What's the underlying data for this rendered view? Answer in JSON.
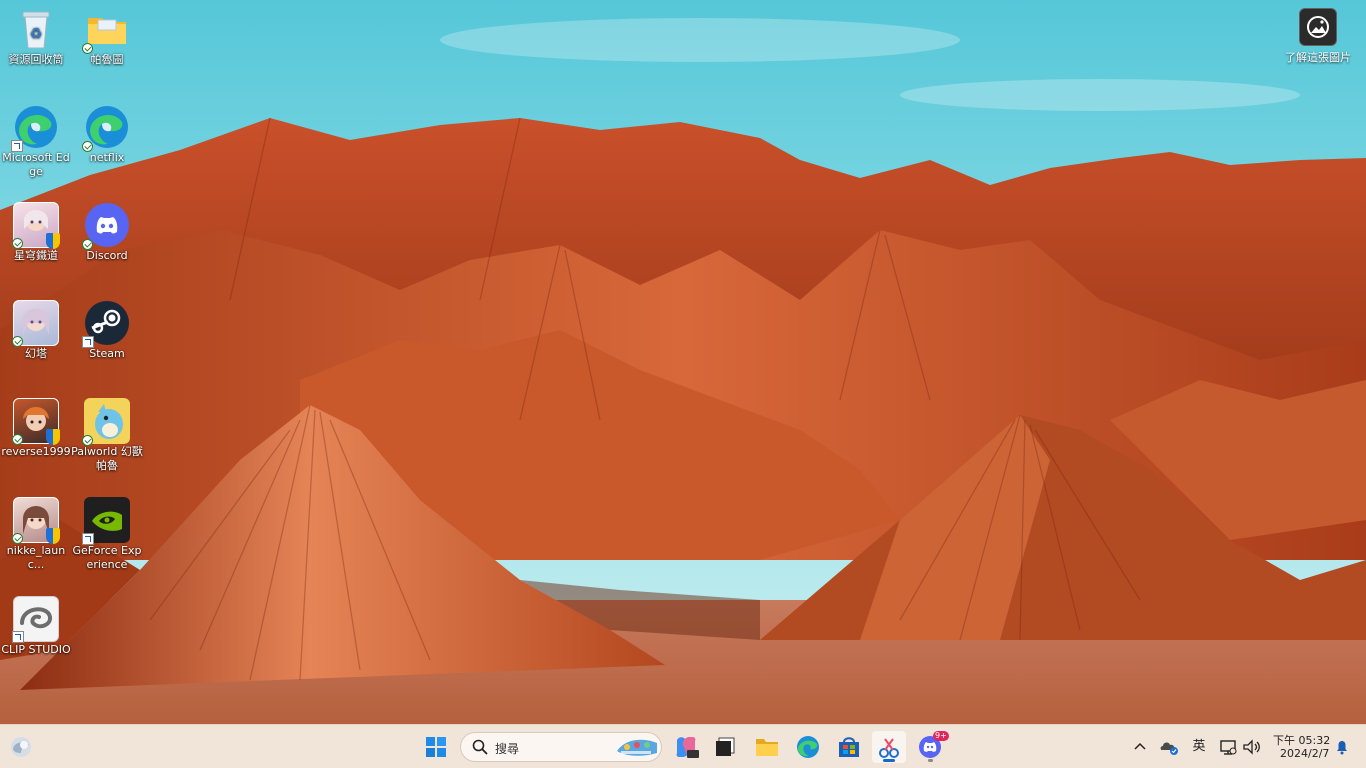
{
  "desktop": {
    "icons": [
      {
        "label": "資源回收筒"
      },
      {
        "label": "帕魯圖"
      },
      {
        "label": "Microsoft Edge"
      },
      {
        "label": "netflix"
      },
      {
        "label": "星穹鐵道"
      },
      {
        "label": "Discord"
      },
      {
        "label": "幻塔"
      },
      {
        "label": "Steam"
      },
      {
        "label": "reverse1999"
      },
      {
        "label": "Palworld 幻獸帕魯"
      },
      {
        "label": "nikke_launc..."
      },
      {
        "label": "GeForce Experience"
      },
      {
        "label": "CLIP STUDIO"
      }
    ],
    "spotlight_label": "了解這張圖片"
  },
  "taskbar": {
    "search_placeholder": "搜尋",
    "discord_badge": "9+",
    "ime_label": "英",
    "clock_time": "下午 05:32",
    "clock_date": "2024/2/7"
  },
  "colors": {
    "sky_top": "#6fd0de",
    "rock_dark": "#8c2c12",
    "rock_mid": "#c65227",
    "rock_light": "#e0774a",
    "taskbar_bg": "#f1e4d8",
    "accent": "#1769c7"
  }
}
